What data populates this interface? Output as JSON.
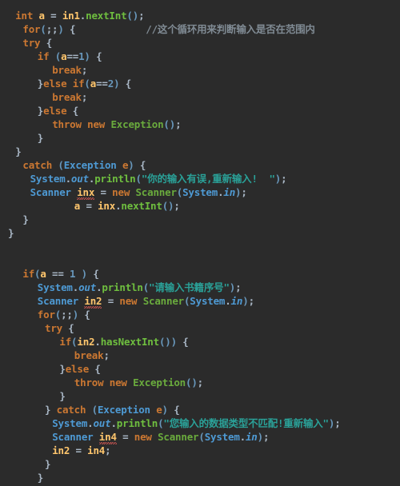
{
  "editor": {
    "background": "#2b2b2b",
    "language": "Java",
    "theme": "darcula",
    "colors": {
      "keyword": "#cc7832",
      "variable": "#ffc66d",
      "type": "#4e9ad4",
      "method": "#6fbf3f",
      "string": "#2aa198",
      "comment": "#808b94",
      "number": "#6897bb",
      "default": "#a9b7c6",
      "error_underline": "#c75450"
    }
  },
  "lines": [
    {
      "indent": 1,
      "tokens": [
        {
          "t": "int",
          "c": "kw"
        },
        {
          "t": " ",
          "c": "plain"
        },
        {
          "t": "a",
          "c": "var"
        },
        {
          "t": " ",
          "c": "plain"
        },
        {
          "t": "=",
          "c": "plain"
        },
        {
          "t": " ",
          "c": "plain"
        },
        {
          "t": "in1",
          "c": "var"
        },
        {
          "t": ".",
          "c": "plain"
        },
        {
          "t": "nextInt",
          "c": "meth"
        },
        {
          "t": "(",
          "c": "num"
        },
        {
          "t": ")",
          "c": "num"
        },
        {
          "t": ";",
          "c": "plain"
        }
      ]
    },
    {
      "indent": 2,
      "tokens": [
        {
          "t": "for",
          "c": "kw"
        },
        {
          "t": "(",
          "c": "num"
        },
        {
          "t": ";;",
          "c": "plain"
        },
        {
          "t": ")",
          "c": "num"
        },
        {
          "t": " {",
          "c": "plain"
        },
        {
          "t": "            ",
          "c": "plain"
        },
        {
          "t": "//这个循环用来判断输入是否在范围内",
          "c": "cmt"
        }
      ]
    },
    {
      "indent": 2,
      "tokens": [
        {
          "t": "try",
          "c": "kw"
        },
        {
          "t": " {",
          "c": "plain"
        }
      ]
    },
    {
      "indent": 4,
      "tokens": [
        {
          "t": "if",
          "c": "kw"
        },
        {
          "t": " ",
          "c": "plain"
        },
        {
          "t": "(",
          "c": "num"
        },
        {
          "t": "a",
          "c": "var"
        },
        {
          "t": "==",
          "c": "plain"
        },
        {
          "t": "1",
          "c": "num"
        },
        {
          "t": ")",
          "c": "num"
        },
        {
          "t": " {",
          "c": "plain"
        }
      ]
    },
    {
      "indent": 6,
      "tokens": [
        {
          "t": "break",
          "c": "kw"
        },
        {
          "t": ";",
          "c": "plain"
        }
      ]
    },
    {
      "indent": 4,
      "tokens": [
        {
          "t": "}",
          "c": "plain"
        },
        {
          "t": "else",
          "c": "kw"
        },
        {
          "t": " ",
          "c": "plain"
        },
        {
          "t": "if",
          "c": "kw"
        },
        {
          "t": "(",
          "c": "num"
        },
        {
          "t": "a",
          "c": "var"
        },
        {
          "t": "==",
          "c": "plain"
        },
        {
          "t": "2",
          "c": "num"
        },
        {
          "t": ")",
          "c": "num"
        },
        {
          "t": " {",
          "c": "plain"
        }
      ]
    },
    {
      "indent": 6,
      "tokens": [
        {
          "t": "break",
          "c": "kw"
        },
        {
          "t": ";",
          "c": "plain"
        }
      ]
    },
    {
      "indent": 4,
      "tokens": [
        {
          "t": "}",
          "c": "plain"
        },
        {
          "t": "else",
          "c": "kw"
        },
        {
          "t": " {",
          "c": "plain"
        }
      ]
    },
    {
      "indent": 6,
      "tokens": [
        {
          "t": "throw",
          "c": "kw"
        },
        {
          "t": " ",
          "c": "plain"
        },
        {
          "t": "new",
          "c": "kw"
        },
        {
          "t": " ",
          "c": "plain"
        },
        {
          "t": "Exception",
          "c": "grn"
        },
        {
          "t": "(",
          "c": "num"
        },
        {
          "t": ")",
          "c": "num"
        },
        {
          "t": ";",
          "c": "plain"
        }
      ]
    },
    {
      "indent": 4,
      "tokens": [
        {
          "t": "}",
          "c": "plain"
        }
      ]
    },
    {
      "indent": 1,
      "tokens": [
        {
          "t": "}",
          "c": "plain"
        }
      ]
    },
    {
      "indent": 2,
      "tokens": [
        {
          "t": "catch",
          "c": "kw"
        },
        {
          "t": " ",
          "c": "plain"
        },
        {
          "t": "(",
          "c": "num"
        },
        {
          "t": "Exception",
          "c": "type"
        },
        {
          "t": " ",
          "c": "plain"
        },
        {
          "t": "e",
          "c": "kw"
        },
        {
          "t": ")",
          "c": "num"
        },
        {
          "t": " {",
          "c": "plain"
        }
      ]
    },
    {
      "indent": 3,
      "tokens": [
        {
          "t": "System",
          "c": "type"
        },
        {
          "t": ".",
          "c": "plain"
        },
        {
          "t": "out",
          "c": "field"
        },
        {
          "t": ".",
          "c": "plain"
        },
        {
          "t": "println",
          "c": "meth"
        },
        {
          "t": "(",
          "c": "num"
        },
        {
          "t": "\"你的输入有误,重新输入!  \"",
          "c": "str"
        },
        {
          "t": ")",
          "c": "num"
        },
        {
          "t": ";",
          "c": "plain"
        }
      ]
    },
    {
      "indent": 3,
      "tokens": [
        {
          "t": "Scanner",
          "c": "type"
        },
        {
          "t": " ",
          "c": "plain"
        },
        {
          "t": "inx",
          "c": "err"
        },
        {
          "t": " ",
          "c": "plain"
        },
        {
          "t": "=",
          "c": "plain"
        },
        {
          "t": " ",
          "c": "plain"
        },
        {
          "t": "new",
          "c": "kw"
        },
        {
          "t": " ",
          "c": "plain"
        },
        {
          "t": "Scanner",
          "c": "grn"
        },
        {
          "t": "(",
          "c": "num"
        },
        {
          "t": "System",
          "c": "type"
        },
        {
          "t": ".",
          "c": "plain"
        },
        {
          "t": "in",
          "c": "field"
        },
        {
          "t": ")",
          "c": "num"
        },
        {
          "t": ";",
          "c": "plain"
        }
      ]
    },
    {
      "indent": 9,
      "tokens": [
        {
          "t": "a",
          "c": "var"
        },
        {
          "t": " ",
          "c": "plain"
        },
        {
          "t": "=",
          "c": "plain"
        },
        {
          "t": " ",
          "c": "plain"
        },
        {
          "t": "inx",
          "c": "var"
        },
        {
          "t": ".",
          "c": "plain"
        },
        {
          "t": "nextInt",
          "c": "meth"
        },
        {
          "t": "(",
          "c": "num"
        },
        {
          "t": ")",
          "c": "num"
        },
        {
          "t": ";",
          "c": "plain"
        }
      ]
    },
    {
      "indent": 2,
      "tokens": [
        {
          "t": "}",
          "c": "plain"
        }
      ]
    },
    {
      "indent": 0,
      "tokens": [
        {
          "t": "}",
          "c": "plain"
        }
      ]
    },
    {
      "indent": 0,
      "tokens": []
    },
    {
      "indent": 0,
      "tokens": []
    },
    {
      "indent": 2,
      "tokens": [
        {
          "t": "if",
          "c": "kw"
        },
        {
          "t": "(",
          "c": "num"
        },
        {
          "t": "a",
          "c": "var"
        },
        {
          "t": " ",
          "c": "plain"
        },
        {
          "t": "==",
          "c": "plain"
        },
        {
          "t": " ",
          "c": "plain"
        },
        {
          "t": "1",
          "c": "num"
        },
        {
          "t": " ",
          "c": "plain"
        },
        {
          "t": ")",
          "c": "num"
        },
        {
          "t": " {",
          "c": "plain"
        }
      ]
    },
    {
      "indent": 4,
      "tokens": [
        {
          "t": "System",
          "c": "type"
        },
        {
          "t": ".",
          "c": "plain"
        },
        {
          "t": "out",
          "c": "field"
        },
        {
          "t": ".",
          "c": "plain"
        },
        {
          "t": "println",
          "c": "meth"
        },
        {
          "t": "(",
          "c": "num"
        },
        {
          "t": "\"请输入书籍序号\"",
          "c": "str"
        },
        {
          "t": ")",
          "c": "num"
        },
        {
          "t": ";",
          "c": "plain"
        }
      ]
    },
    {
      "indent": 4,
      "tokens": [
        {
          "t": "Scanner",
          "c": "type"
        },
        {
          "t": " ",
          "c": "plain"
        },
        {
          "t": "in2",
          "c": "err"
        },
        {
          "t": " ",
          "c": "plain"
        },
        {
          "t": "=",
          "c": "plain"
        },
        {
          "t": " ",
          "c": "plain"
        },
        {
          "t": "new",
          "c": "kw"
        },
        {
          "t": " ",
          "c": "plain"
        },
        {
          "t": "Scanner",
          "c": "grn"
        },
        {
          "t": "(",
          "c": "num"
        },
        {
          "t": "System",
          "c": "type"
        },
        {
          "t": ".",
          "c": "plain"
        },
        {
          "t": "in",
          "c": "field"
        },
        {
          "t": ")",
          "c": "num"
        },
        {
          "t": ";",
          "c": "plain"
        }
      ]
    },
    {
      "indent": 4,
      "tokens": [
        {
          "t": "for",
          "c": "kw"
        },
        {
          "t": "(",
          "c": "num"
        },
        {
          "t": ";;",
          "c": "plain"
        },
        {
          "t": ")",
          "c": "num"
        },
        {
          "t": " {",
          "c": "plain"
        }
      ]
    },
    {
      "indent": 5,
      "tokens": [
        {
          "t": "try",
          "c": "kw"
        },
        {
          "t": " {",
          "c": "plain"
        }
      ]
    },
    {
      "indent": 7,
      "tokens": [
        {
          "t": "if",
          "c": "kw"
        },
        {
          "t": "(",
          "c": "num"
        },
        {
          "t": "in2",
          "c": "var"
        },
        {
          "t": ".",
          "c": "plain"
        },
        {
          "t": "hasNextInt",
          "c": "meth"
        },
        {
          "t": "(",
          "c": "num"
        },
        {
          "t": ")",
          "c": "num"
        },
        {
          "t": ")",
          "c": "num"
        },
        {
          "t": " {",
          "c": "plain"
        }
      ]
    },
    {
      "indent": 9,
      "tokens": [
        {
          "t": "break",
          "c": "kw"
        },
        {
          "t": ";",
          "c": "plain"
        }
      ]
    },
    {
      "indent": 7,
      "tokens": [
        {
          "t": "}",
          "c": "plain"
        },
        {
          "t": "else",
          "c": "kw"
        },
        {
          "t": " {",
          "c": "plain"
        }
      ]
    },
    {
      "indent": 9,
      "tokens": [
        {
          "t": "throw",
          "c": "kw"
        },
        {
          "t": " ",
          "c": "plain"
        },
        {
          "t": "new",
          "c": "kw"
        },
        {
          "t": " ",
          "c": "plain"
        },
        {
          "t": "Exception",
          "c": "grn"
        },
        {
          "t": "(",
          "c": "num"
        },
        {
          "t": ")",
          "c": "num"
        },
        {
          "t": ";",
          "c": "plain"
        }
      ]
    },
    {
      "indent": 7,
      "tokens": [
        {
          "t": "}",
          "c": "plain"
        }
      ]
    },
    {
      "indent": 5,
      "tokens": [
        {
          "t": "}",
          "c": "plain"
        },
        {
          "t": " ",
          "c": "plain"
        },
        {
          "t": "catch",
          "c": "kw"
        },
        {
          "t": " ",
          "c": "plain"
        },
        {
          "t": "(",
          "c": "num"
        },
        {
          "t": "Exception",
          "c": "type"
        },
        {
          "t": " ",
          "c": "plain"
        },
        {
          "t": "e",
          "c": "kw"
        },
        {
          "t": ")",
          "c": "num"
        },
        {
          "t": " {",
          "c": "plain"
        }
      ]
    },
    {
      "indent": 6,
      "tokens": [
        {
          "t": "System",
          "c": "type"
        },
        {
          "t": ".",
          "c": "plain"
        },
        {
          "t": "out",
          "c": "field"
        },
        {
          "t": ".",
          "c": "plain"
        },
        {
          "t": "println",
          "c": "meth"
        },
        {
          "t": "(",
          "c": "num"
        },
        {
          "t": "\"您输入的数据类型不匹配!重新输入\"",
          "c": "str"
        },
        {
          "t": ")",
          "c": "num"
        },
        {
          "t": ";",
          "c": "plain"
        }
      ]
    },
    {
      "indent": 6,
      "tokens": [
        {
          "t": "Scanner",
          "c": "type"
        },
        {
          "t": " ",
          "c": "plain"
        },
        {
          "t": "in4",
          "c": "err"
        },
        {
          "t": " ",
          "c": "plain"
        },
        {
          "t": "=",
          "c": "plain"
        },
        {
          "t": " ",
          "c": "plain"
        },
        {
          "t": "new",
          "c": "kw"
        },
        {
          "t": " ",
          "c": "plain"
        },
        {
          "t": "Scanner",
          "c": "grn"
        },
        {
          "t": "(",
          "c": "num"
        },
        {
          "t": "System",
          "c": "type"
        },
        {
          "t": ".",
          "c": "plain"
        },
        {
          "t": "in",
          "c": "field"
        },
        {
          "t": ")",
          "c": "num"
        },
        {
          "t": ";",
          "c": "plain"
        }
      ]
    },
    {
      "indent": 6,
      "tokens": [
        {
          "t": "in2",
          "c": "var"
        },
        {
          "t": " ",
          "c": "plain"
        },
        {
          "t": "=",
          "c": "plain"
        },
        {
          "t": " ",
          "c": "plain"
        },
        {
          "t": "in4",
          "c": "var"
        },
        {
          "t": ";",
          "c": "plain"
        }
      ]
    },
    {
      "indent": 5,
      "tokens": [
        {
          "t": "}",
          "c": "plain"
        }
      ]
    },
    {
      "indent": 4,
      "tokens": [
        {
          "t": "}",
          "c": "plain"
        }
      ]
    }
  ]
}
